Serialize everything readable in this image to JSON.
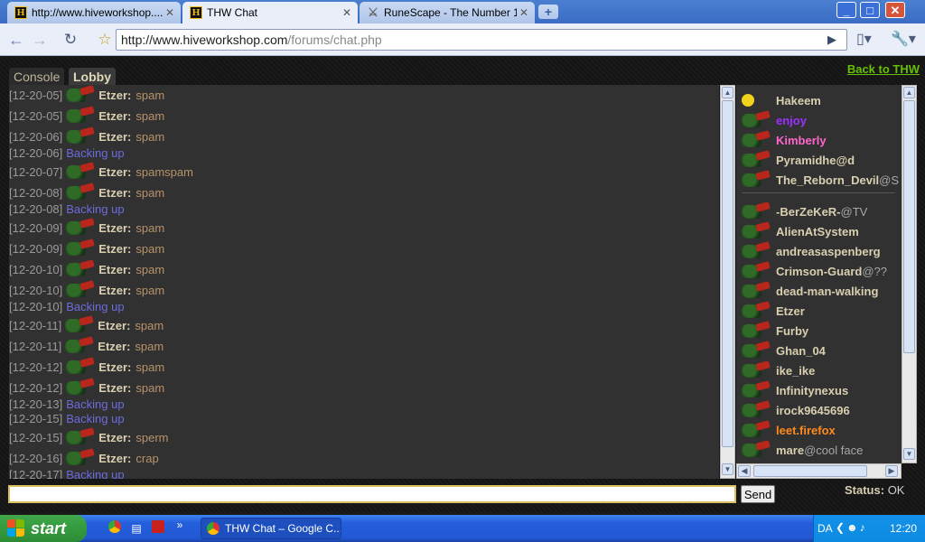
{
  "browser": {
    "tabs": [
      {
        "label": "http://www.hiveworkshop....",
        "favicon": "hive-icon",
        "active": false
      },
      {
        "label": "THW Chat",
        "favicon": "hive-icon",
        "active": true
      },
      {
        "label": "RuneScape - The Number 1...",
        "favicon": "runescape-sword-icon",
        "active": false
      }
    ],
    "new_tab": "+",
    "url_host": "http://www.hiveworkshop.com",
    "url_path": "/forums/chat.php",
    "buttons": {
      "back": "←",
      "forward": "→",
      "reload": "↻",
      "star": "☆",
      "go": "▶",
      "page": "▯▾",
      "wrench": "🔧▾"
    },
    "window": {
      "min": "_",
      "max": "□",
      "close": "✕"
    }
  },
  "chat": {
    "back_link": "Back to THW",
    "tabs": {
      "console": "Console",
      "lobby": "Lobby"
    },
    "messages": [
      {
        "ts": "[12-20-05]",
        "nick": "Etzer:",
        "text": "spam"
      },
      {
        "ts": "[12-20-05]",
        "nick": "Etzer:",
        "text": "spam"
      },
      {
        "ts": "[12-20-06]",
        "nick": "Etzer:",
        "text": "spam"
      },
      {
        "ts": "[12-20-06]",
        "system": "Backing up"
      },
      {
        "ts": "[12-20-07]",
        "nick": "Etzer:",
        "text": "spamspam"
      },
      {
        "ts": "[12-20-08]",
        "nick": "Etzer:",
        "text": "spam"
      },
      {
        "ts": "[12-20-08]",
        "system": "Backing up"
      },
      {
        "ts": "[12-20-09]",
        "nick": "Etzer:",
        "text": "spam"
      },
      {
        "ts": "[12-20-09]",
        "nick": "Etzer:",
        "text": "spam"
      },
      {
        "ts": "[12-20-10]",
        "nick": "Etzer:",
        "text": "spam"
      },
      {
        "ts": "[12-20-10]",
        "nick": "Etzer:",
        "text": "spam"
      },
      {
        "ts": "[12-20-10]",
        "system": "Backing up"
      },
      {
        "ts": "[12-20-11]",
        "nick": "Etzer:",
        "text": "spam"
      },
      {
        "ts": "[12-20-11]",
        "nick": "Etzer:",
        "text": "spam"
      },
      {
        "ts": "[12-20-12]",
        "nick": "Etzer:",
        "text": "spam"
      },
      {
        "ts": "[12-20-12]",
        "nick": "Etzer:",
        "text": "spam"
      },
      {
        "ts": "[12-20-13]",
        "system": "Backing up"
      },
      {
        "ts": "[12-20-15]",
        "system": "Backing up"
      },
      {
        "ts": "[12-20-15]",
        "nick": "Etzer:",
        "text": "sperm"
      },
      {
        "ts": "[12-20-16]",
        "nick": "Etzer:",
        "text": "crap"
      },
      {
        "ts": "[12-20-17]",
        "system": "Backing up"
      }
    ],
    "users_top": [
      {
        "name": "Hakeem",
        "avatar": "smiley-icon",
        "color": "#d9cfb0"
      },
      {
        "name": "enjoy",
        "color": "#9b30ff"
      },
      {
        "name": "Kimberly",
        "color": "#ff66cc"
      },
      {
        "name": "Pyramidhe@d",
        "color": "#d9cfb0"
      },
      {
        "name": "The_Reborn_Devil",
        "status": "@S",
        "color": "#d9cfb0"
      }
    ],
    "users": [
      {
        "name": "-BerZeKeR-",
        "status": "@TV",
        "color": "#d9cfb0"
      },
      {
        "name": "AlienAtSystem",
        "color": "#d9cfb0"
      },
      {
        "name": "andreasaspenberg",
        "color": "#d9cfb0"
      },
      {
        "name": "Crimson-Guard",
        "status": "@??",
        "color": "#d9cfb0"
      },
      {
        "name": "dead-man-walking",
        "color": "#d9cfb0"
      },
      {
        "name": "Etzer",
        "color": "#d9cfb0"
      },
      {
        "name": "Furby",
        "color": "#d9cfb0"
      },
      {
        "name": "Ghan_04",
        "color": "#d9cfb0"
      },
      {
        "name": "ike_ike",
        "color": "#d9cfb0"
      },
      {
        "name": "Infinitynexus",
        "color": "#d9cfb0"
      },
      {
        "name": "irock9645696",
        "color": "#d9cfb0"
      },
      {
        "name": "leet.firefox",
        "color": "#ff8a1e"
      },
      {
        "name": "mare",
        "status": "@cool face",
        "color": "#d9cfb0"
      }
    ],
    "input_value": "",
    "send_label": "Send",
    "status_label": "Status:",
    "status_value": "OK"
  },
  "taskbar": {
    "start_label": "start",
    "task_label": "THW Chat – Google C...",
    "expand": "»",
    "language": "DA",
    "clock": "12:20"
  }
}
